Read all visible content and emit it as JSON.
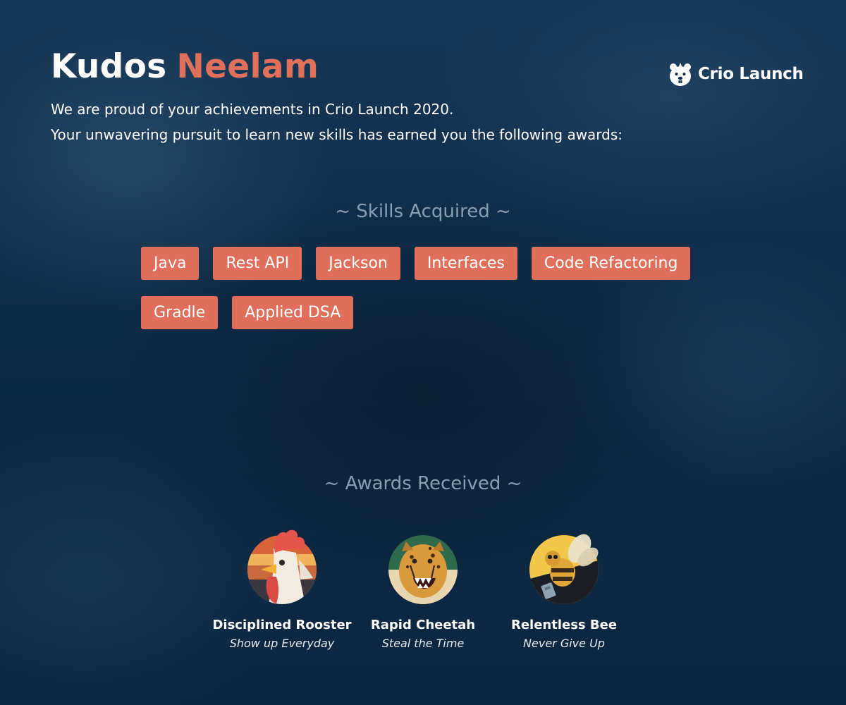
{
  "header": {
    "greeting": "Kudos",
    "name": "Neelam",
    "line1": "We are proud of your achievements in Crio Launch 2020.",
    "line2": "Your unwavering pursuit to learn new skills has earned you the following awards:"
  },
  "brand": {
    "text": "Crio Launch",
    "icon": "beaver-logo-icon"
  },
  "skills": {
    "heading": "~ Skills Acquired ~",
    "items": [
      "Java",
      "Rest API",
      "Jackson",
      "Interfaces",
      "Code Refactoring",
      "Gradle",
      "Applied DSA"
    ]
  },
  "awards": {
    "heading": "~ Awards Received ~",
    "items": [
      {
        "name": "Disciplined Rooster",
        "tagline": "Show up Everyday",
        "icon": "rooster-badge-icon"
      },
      {
        "name": "Rapid Cheetah",
        "tagline": "Steal the Time",
        "icon": "cheetah-badge-icon"
      },
      {
        "name": "Relentless Bee",
        "tagline": "Never Give Up",
        "icon": "bee-badge-icon"
      }
    ]
  },
  "colors": {
    "background": "#0f2b44",
    "accent": "#e0705a",
    "heading_muted": "#8a9fb2",
    "text": "#ffffff"
  }
}
